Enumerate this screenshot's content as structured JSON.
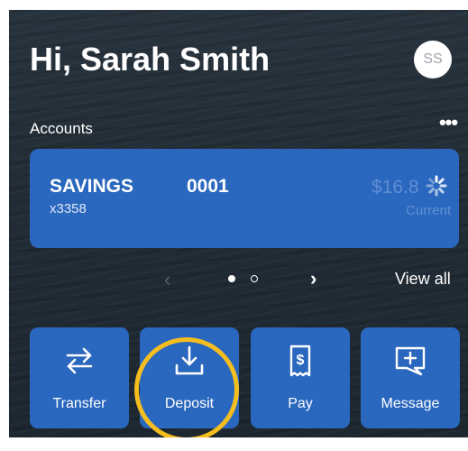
{
  "header": {
    "greeting": "Hi, Sarah Smith",
    "avatar_initials": "SS"
  },
  "accounts_section": {
    "label": "Accounts",
    "more_label": "•••"
  },
  "account": {
    "name": "SAVINGS",
    "number": "0001",
    "masked": "x3358",
    "balance": "$16.8",
    "balance_label": "Current",
    "loading_icon": "spinner-icon"
  },
  "pager": {
    "prev_label": "‹",
    "next_label": "›",
    "view_all_label": "View all",
    "page": 1,
    "page_count": 2
  },
  "actions": [
    {
      "label": "Transfer",
      "icon": "transfer-icon"
    },
    {
      "label": "Deposit",
      "icon": "deposit-icon"
    },
    {
      "label": "Pay",
      "icon": "pay-icon"
    },
    {
      "label": "Message",
      "icon": "message-icon"
    }
  ],
  "colors": {
    "card": "#2a67be",
    "background": "#232d36",
    "highlight": "#f5be1f"
  }
}
